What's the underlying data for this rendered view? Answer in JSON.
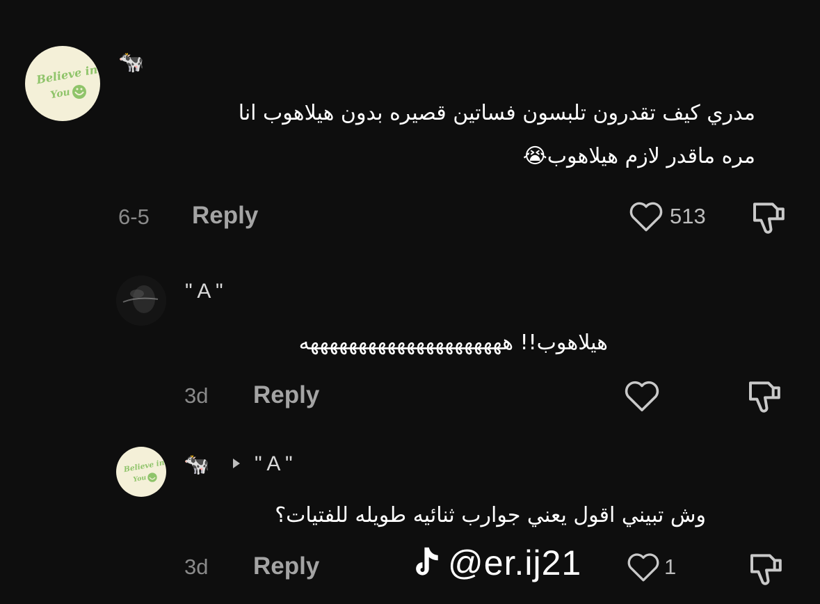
{
  "colors": {
    "background": "#0e0e0e",
    "text_primary": "#ffffff",
    "text_secondary": "#8a8a8a",
    "avatar_badge_bg": "#f4f0d8",
    "avatar_badge_text": "#8fc46a"
  },
  "comments": [
    {
      "username": "🐄",
      "avatar_icon": "believe-in-you-badge",
      "avatar_text_line1": "Believe in",
      "avatar_text_line2": "You",
      "text_line1": "مدري كيف تقدرون تلبسون فساتين قصيره بدون هيلاهوب انا",
      "text_line2": "مره ماقدر لازم هيلاهوب😭",
      "date": "6-5",
      "reply_label": "Reply",
      "likes": "513"
    },
    {
      "username": "\" A \"",
      "avatar_icon": "photo-avatar",
      "text_line1": "هيلاهوب!! هههههههههههههههههههههه",
      "date": "3d",
      "reply_label": "Reply",
      "likes": ""
    },
    {
      "username": "🐄",
      "reply_to": "\" A \"",
      "avatar_icon": "believe-in-you-badge",
      "avatar_text_line1": "Believe in",
      "avatar_text_line2": "You",
      "text_line1": "وش تبيني اقول يعني جوارب ثنائيه طويله للفتيات؟",
      "date": "3d",
      "reply_label": "Reply",
      "likes": "1"
    }
  ],
  "watermark": {
    "icon": "tiktok-icon",
    "handle": "@er.ij21"
  }
}
